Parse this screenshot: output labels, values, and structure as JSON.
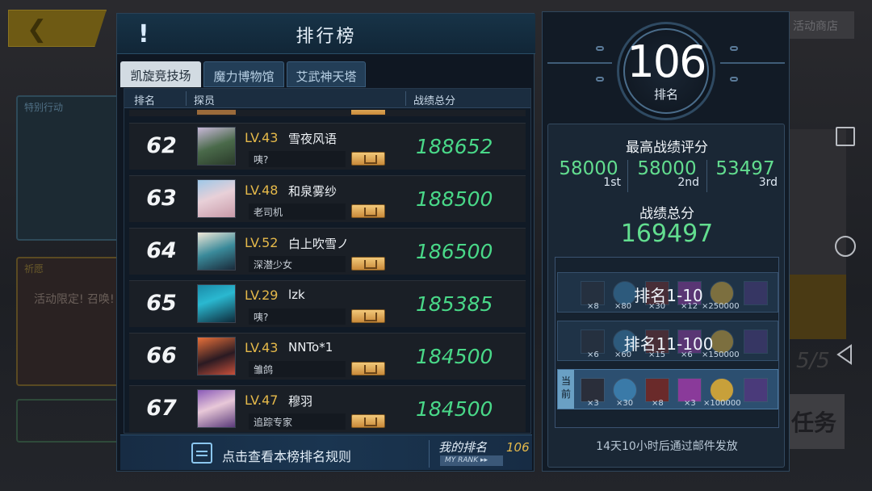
{
  "background": {
    "card1_label": "特别行动",
    "card2_label": "祈愿",
    "card2_sub": "活动限定! 召唤!",
    "top_right_label": "活动商店",
    "task_label": "任务",
    "count_text": "5/5"
  },
  "ranking": {
    "title": "排行榜",
    "tabs": [
      {
        "label": "凯旋竞技场"
      },
      {
        "label": "魔力博物馆"
      },
      {
        "label": "艾武神天塔"
      }
    ],
    "columns": {
      "rank": "排名",
      "member": "探员",
      "score": "战绩总分"
    },
    "rows": [
      {
        "rank": "62",
        "level": "LV.43",
        "name": "雪夜风语",
        "signature": "咦?",
        "score": "188652"
      },
      {
        "rank": "63",
        "level": "LV.48",
        "name": "和泉雾纱",
        "signature": "老司机",
        "score": "188500"
      },
      {
        "rank": "64",
        "level": "LV.52",
        "name": "白上吹雪ノ",
        "signature": "深潜少女",
        "score": "186500"
      },
      {
        "rank": "65",
        "level": "LV.29",
        "name": "lzk",
        "signature": "咦?",
        "score": "185385"
      },
      {
        "rank": "66",
        "level": "LV.43",
        "name": "NNTo*1",
        "signature": "雏鸽",
        "score": "184500"
      },
      {
        "rank": "67",
        "level": "LV.47",
        "name": "穆羽",
        "signature": "追踪专家",
        "score": "184500"
      }
    ],
    "footer": {
      "rules_text": "点击查看本榜排名规则",
      "my_rank_label": "我的排名",
      "my_rank_tag": "MY RANK ▸▸",
      "my_rank_value": "106"
    }
  },
  "summary": {
    "rank": "106",
    "rank_label": "排名",
    "best_title": "最高战绩评分",
    "best_scores": [
      {
        "value": "58000",
        "place": "1st"
      },
      {
        "value": "58000",
        "place": "2nd"
      },
      {
        "value": "53497",
        "place": "3rd"
      }
    ],
    "total_title": "战绩总分",
    "total_value": "169497",
    "rewards": [
      {
        "label": "排名1-10",
        "qty": [
          "×8",
          "×80",
          "×30",
          "×12",
          "×250000"
        ]
      },
      {
        "label": "排名11-100",
        "qty": [
          "×6",
          "×60",
          "×15",
          "×6",
          "×150000"
        ]
      },
      {
        "label": "",
        "current_tag": "当前",
        "qty": [
          "×3",
          "×30",
          "×8",
          "×3",
          "×100000"
        ]
      }
    ],
    "mail_note": "14天10小时后通过邮件发放"
  },
  "colors": {
    "score_green": "#49d888",
    "level_gold": "#e5b94a",
    "panel_bg": "#0f1722"
  }
}
